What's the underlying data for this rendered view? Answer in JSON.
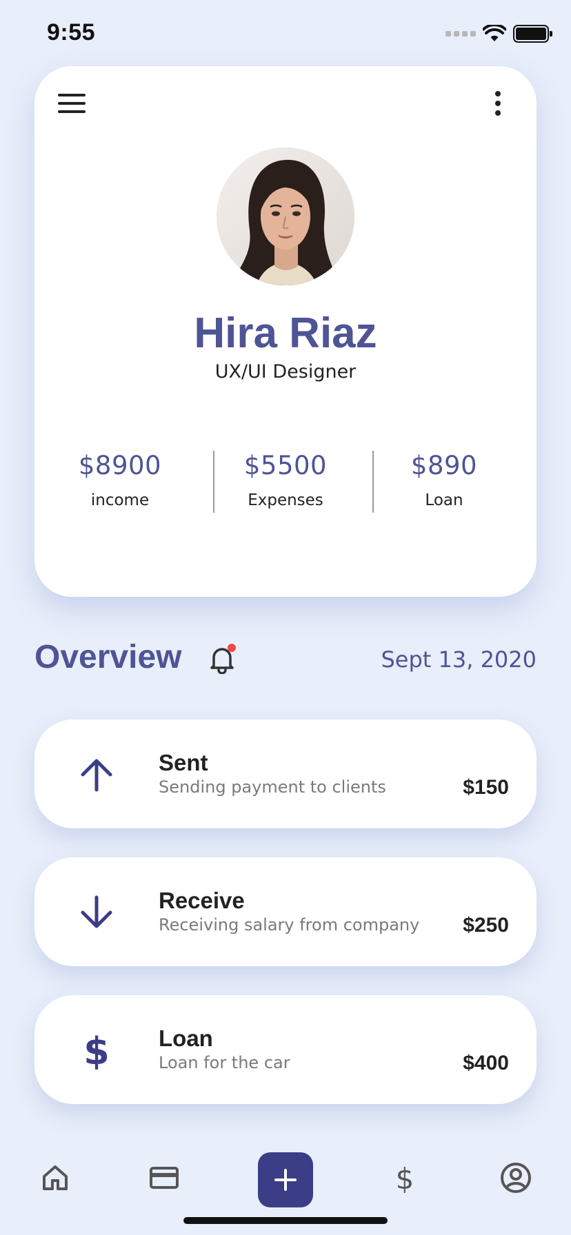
{
  "status_bar": {
    "time": "9:55",
    "icons": [
      "signal-icon",
      "wifi-icon",
      "battery-icon"
    ]
  },
  "profile": {
    "name": "Hira Riaz",
    "role": "UX/UI Designer",
    "avatar": "profile-photo",
    "stats": [
      {
        "value": "$8900",
        "label": "income"
      },
      {
        "value": "$5500",
        "label": "Expenses"
      },
      {
        "value": "$890",
        "label": "Loan"
      }
    ]
  },
  "overview": {
    "title": "Overview",
    "date": "Sept 13, 2020",
    "has_notification": true
  },
  "transactions": [
    {
      "icon": "arrow-up-icon",
      "title": "Sent",
      "description": "Sending payment to clients",
      "amount": "$150"
    },
    {
      "icon": "arrow-down-icon",
      "title": "Receive",
      "description": "Receiving salary from company",
      "amount": "$250"
    },
    {
      "icon": "dollar-icon",
      "title": "Loan",
      "description": "Loan for the car",
      "amount": "$400"
    }
  ],
  "nav": {
    "items": [
      "home-icon",
      "card-icon",
      "add-icon",
      "dollar-icon",
      "profile-icon"
    ]
  },
  "colors": {
    "background": "#e8eefa",
    "accent": "#4e5495",
    "accent_dark": "#3b3e86",
    "notification": "#f04747"
  }
}
